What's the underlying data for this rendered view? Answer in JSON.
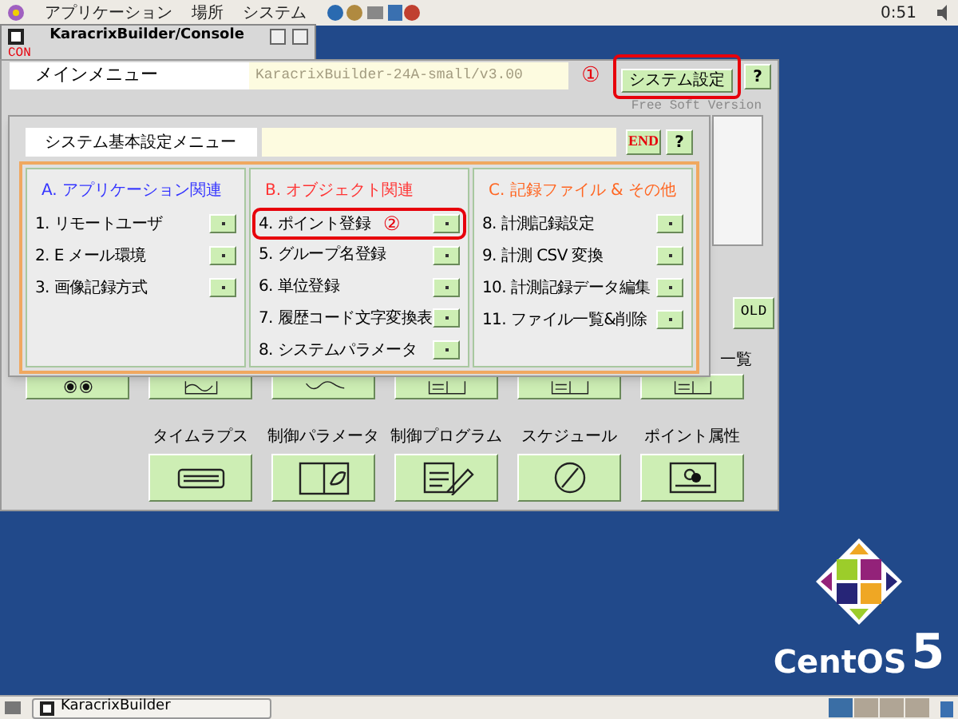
{
  "top_panel": {
    "menus": [
      "アプリケーション",
      "場所",
      "システム"
    ],
    "clock": "0:51"
  },
  "console_window": {
    "title": "KaracrixBuilder/Console",
    "status": "CON"
  },
  "main_window": {
    "menu_title": "メインメニュー",
    "version": "KaracrixBuilder-24A-small/v3.00",
    "marker": "①",
    "settings_button": "システム設定",
    "help_button": "?",
    "edition": "Free Soft Version",
    "hold_button": "OLD",
    "list_label": "一覧",
    "tools": [
      "タイムラプス",
      "制御パラメータ",
      "制御プログラム",
      "スケジュール",
      "ポイント属性"
    ]
  },
  "submenu_window": {
    "title": "システム基本設定メニュー",
    "end_button": "END",
    "help_button": "?",
    "columns": [
      {
        "heading": "A. アプリケーション関連",
        "color": "#3333ff",
        "items": [
          {
            "label": "1. リモートユーザ",
            "highlighted": false
          },
          {
            "label": "2. E メール環境",
            "highlighted": false
          },
          {
            "label": "3. 画像記録方式",
            "highlighted": false
          }
        ]
      },
      {
        "heading": "B. オブジェクト関連",
        "color": "#ff3333",
        "items": [
          {
            "label": "4. ポイント登録",
            "highlighted": true,
            "marker": "②"
          },
          {
            "label": "5. グループ名登録",
            "highlighted": false
          },
          {
            "label": "6. 単位登録",
            "highlighted": false
          },
          {
            "label": "7. 履歴コード文字変換表",
            "highlighted": false
          },
          {
            "label": "8. システムパラメータ",
            "highlighted": false
          }
        ]
      },
      {
        "heading": "C. 記録ファイル & その他",
        "color": "#ff6622",
        "items": [
          {
            "label": "8. 計測記録設定",
            "highlighted": false
          },
          {
            "label": "9. 計測 CSV 変換",
            "highlighted": false
          },
          {
            "label": "10. 計測記録データ編集",
            "highlighted": false
          },
          {
            "label": "11. ファイル一覧&削除",
            "highlighted": false
          }
        ]
      }
    ]
  },
  "desktop": {
    "logo_text": "CentOS",
    "logo_version": "5"
  },
  "taskbar": {
    "items": [
      "KaracrixBuilder"
    ]
  }
}
